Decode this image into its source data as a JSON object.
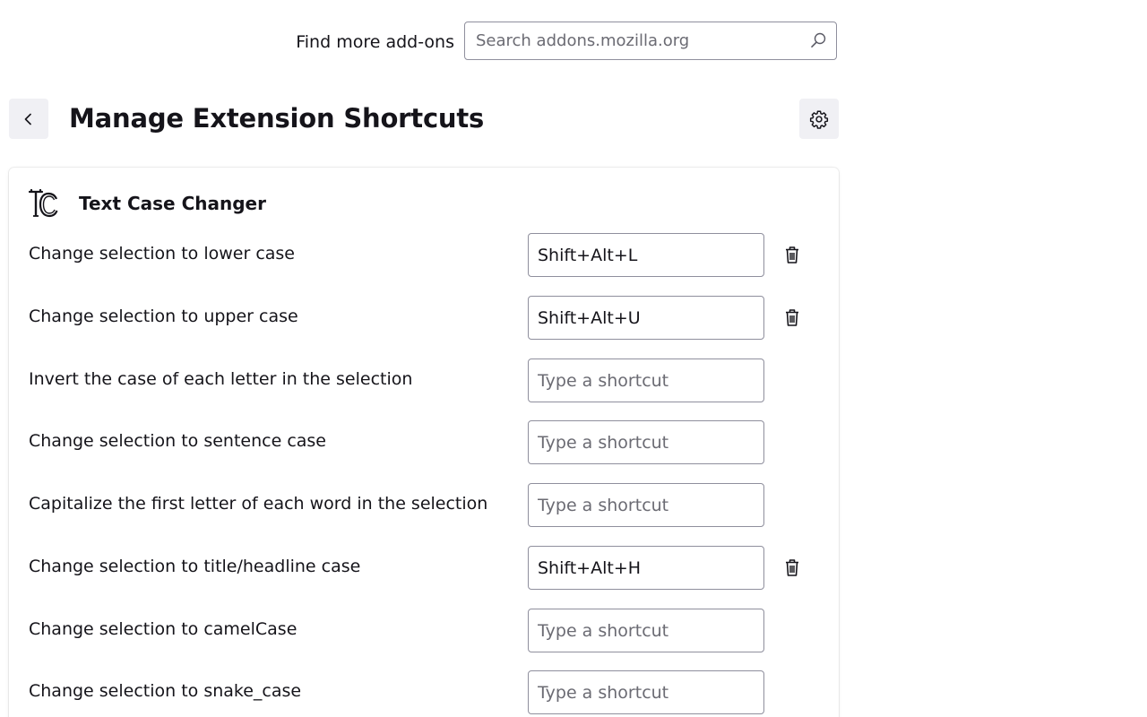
{
  "search": {
    "label": "Find more add-ons",
    "placeholder": "Search addons.mozilla.org",
    "value": ""
  },
  "header": {
    "title": "Manage Extension Shortcuts"
  },
  "extension": {
    "name": "Text Case Changer",
    "icon_text": "TC",
    "shortcut_placeholder": "Type a shortcut",
    "commands": [
      {
        "label": "Change selection to lower case",
        "shortcut": "Shift+Alt+L"
      },
      {
        "label": "Change selection to upper case",
        "shortcut": "Shift+Alt+U"
      },
      {
        "label": "Invert the case of each letter in the selection",
        "shortcut": ""
      },
      {
        "label": "Change selection to sentence case",
        "shortcut": ""
      },
      {
        "label": "Capitalize the first letter of each word in the selection",
        "shortcut": ""
      },
      {
        "label": "Change selection to title/headline case",
        "shortcut": "Shift+Alt+H"
      },
      {
        "label": "Change selection to camelCase",
        "shortcut": ""
      },
      {
        "label": "Change selection to snake_case",
        "shortcut": ""
      }
    ]
  }
}
